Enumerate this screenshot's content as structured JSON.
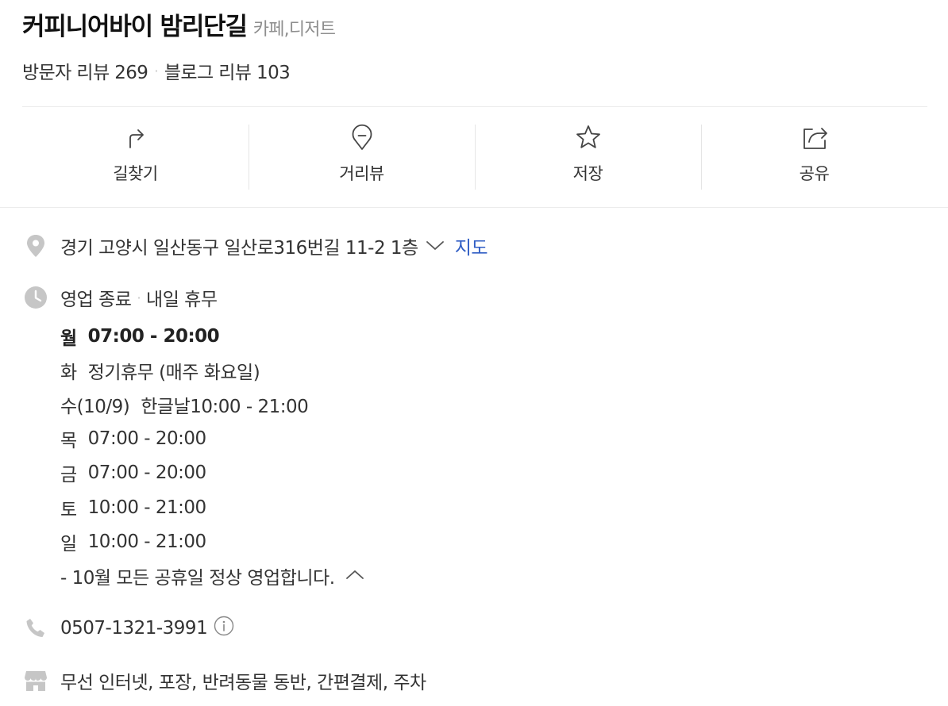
{
  "header": {
    "name": "커피니어바이 밤리단길",
    "category": "카페,디저트",
    "visitor_reviews": "방문자 리뷰 269",
    "separator": "·",
    "blog_reviews": "블로그 리뷰 103"
  },
  "actions": {
    "directions": "길찾기",
    "streetview": "거리뷰",
    "save": "저장",
    "share": "공유"
  },
  "address": {
    "text": "경기 고양시 일산동구 일산로316번길 11-2 1층",
    "map_link": "지도"
  },
  "status": {
    "state": "영업 종료",
    "separator": "·",
    "next": "내일 휴무"
  },
  "hours": [
    {
      "day": "월",
      "time": "07:00 - 20:00"
    },
    {
      "day": "화",
      "time": "정기휴무 (매주 화요일)"
    },
    {
      "day": "수(10/9)",
      "time": "한글날10:00 - 21:00"
    },
    {
      "day": "목",
      "time": "07:00 - 20:00"
    },
    {
      "day": "금",
      "time": "07:00 - 20:00"
    },
    {
      "day": "토",
      "time": "10:00 - 21:00"
    },
    {
      "day": "일",
      "time": "10:00 - 21:00"
    }
  ],
  "hours_note": "- 10월 모든 공휴일 정상 영업합니다.",
  "phone": "0507-1321-3991",
  "amenities": "무선 인터넷, 포장, 반려동물 동반, 간편결제, 주차",
  "colors": {
    "link": "#2f5dc4",
    "icon_gray": "#c6c6c6",
    "divider": "#ececec"
  }
}
